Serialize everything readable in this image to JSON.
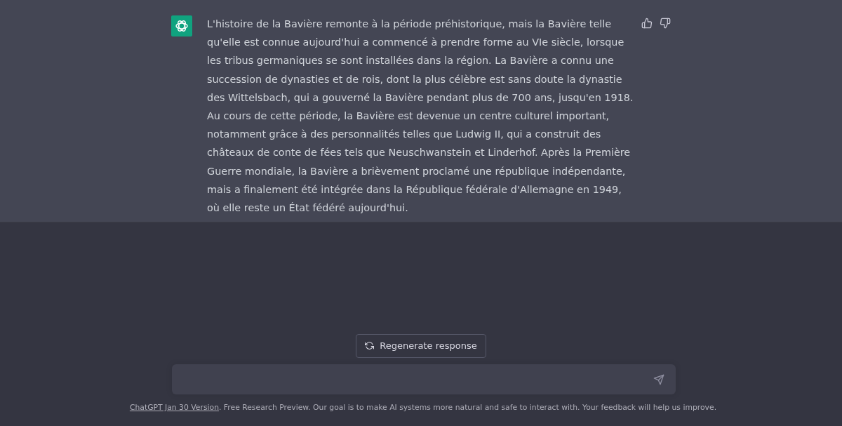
{
  "message": {
    "text": "L'histoire de la Bavière remonte à la période préhistorique, mais la Bavière telle qu'elle est connue aujourd'hui a commencé à prendre forme au VIe siècle, lorsque les tribus germaniques se sont installées dans la région. La Bavière a connu une succession de dynasties et de rois, dont la plus célèbre est sans doute la dynastie des Wittelsbach, qui a gouverné la Bavière pendant plus de 700 ans, jusqu'en 1918. Au cours de cette période, la Bavière est devenue un centre culturel important, notamment grâce à des personnalités telles que Ludwig II, qui a construit des châteaux de conte de fées tels que Neuschwanstein et Linderhof. Après la Première Guerre mondiale, la Bavière a brièvement proclamé une république indépendante, mais a finalement été intégrée dans la République fédérale d'Allemagne en 1949, où elle reste un État fédéré aujourd'hui."
  },
  "regenerate_button": {
    "label": "Regenerate response"
  },
  "footer": {
    "link": "ChatGPT Jan 30 Version",
    "text": ". Free Research Preview. Our goal is to make AI systems more natural and safe to interact with. Your feedback will help us improve."
  }
}
